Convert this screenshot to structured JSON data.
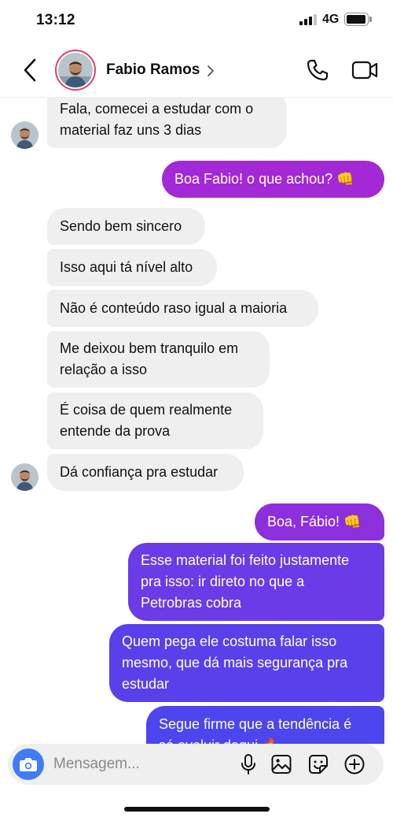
{
  "status_bar": {
    "time": "13:12",
    "network": "4G",
    "signal_bars": "3 of 4",
    "battery_level": 0.85
  },
  "header": {
    "contact_name": "Fabio Ramos",
    "icons": [
      "back-arrow-icon",
      "chevron-right-icon",
      "phone-icon",
      "video-camera-icon"
    ]
  },
  "messages": [
    {
      "side": "in",
      "lines": [
        "Fala, comecei a estudar com o",
        "material faz uns 3 dias"
      ]
    },
    {
      "side": "out",
      "lines": [
        "Boa Fabio! o que achou? 👊"
      ]
    },
    {
      "side": "in",
      "lines": [
        "Sendo bem sincero"
      ]
    },
    {
      "side": "in",
      "lines": [
        "Isso aqui tá nível alto"
      ]
    },
    {
      "side": "in",
      "lines": [
        "Não é conteúdo raso igual a maioria"
      ]
    },
    {
      "side": "in",
      "lines": [
        "Me deixou bem tranquilo em",
        "relação a isso"
      ]
    },
    {
      "side": "in",
      "lines": [
        "É coisa de quem realmente",
        "entende da prova"
      ]
    },
    {
      "side": "in",
      "lines": [
        "Dá confiança pra estudar"
      ]
    },
    {
      "side": "out",
      "lines": [
        "Boa, Fábio! 👊"
      ]
    },
    {
      "side": "out",
      "lines": [
        "Esse material foi feito justamente",
        "pra isso: ir direto no que a",
        "Petrobras cobra"
      ]
    },
    {
      "side": "out",
      "lines": [
        "Quem pega ele costuma falar isso",
        "mesmo, que dá mais segurança pra",
        "estudar"
      ]
    },
    {
      "side": "out",
      "lines": [
        "Segue firme que a tendência é",
        "só evoluir daqui 🔥"
      ]
    }
  ],
  "composer": {
    "placeholder": "Mensagem...",
    "icons": [
      "camera-icon",
      "microphone-icon",
      "gallery-icon",
      "sticker-icon",
      "add-icon"
    ]
  },
  "colors": {
    "incoming_bubble": "#efefef",
    "outgoing_gradient_top": "#a328d6",
    "outgoing_gradient_bottom": "#4d45ee",
    "camera_button": "#3f7cf7",
    "avatar_ring": "#e4405f"
  }
}
